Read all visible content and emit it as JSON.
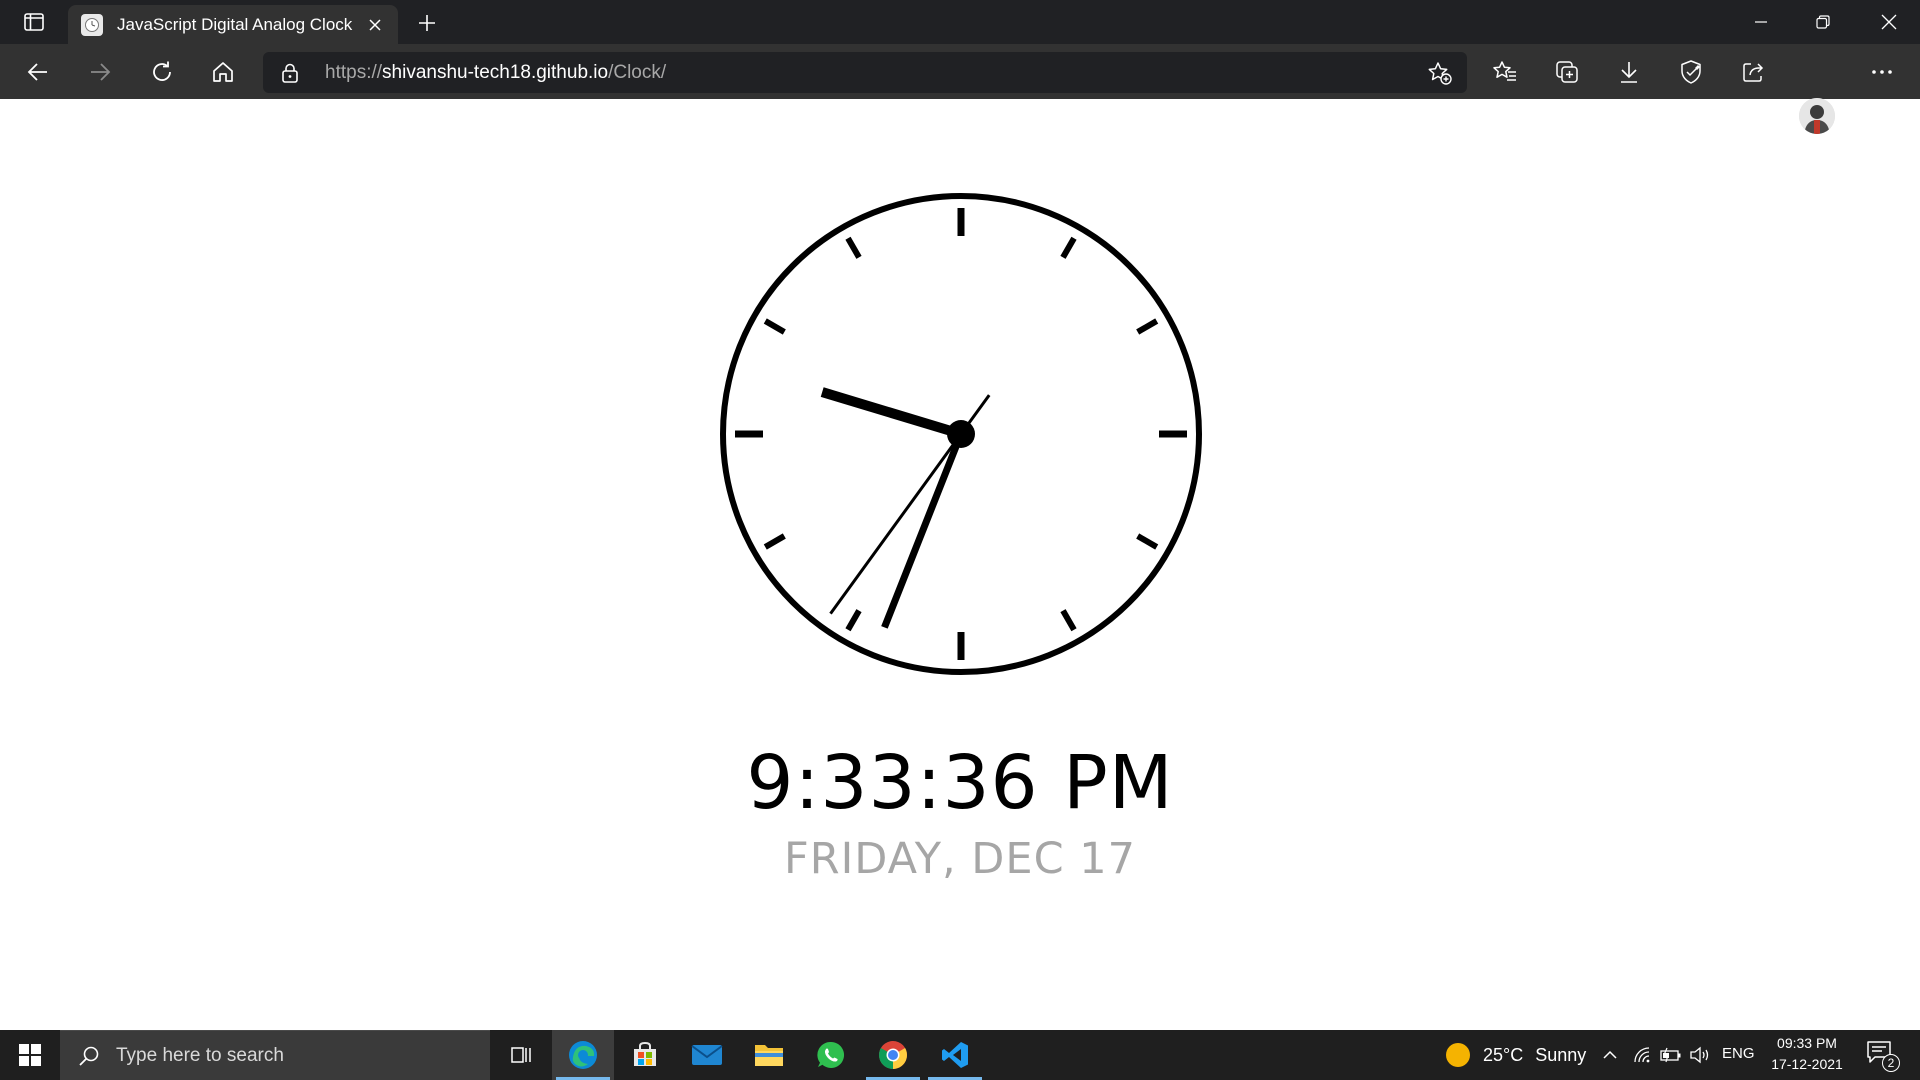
{
  "browser": {
    "tab_title": "JavaScript Digital Analog Clock",
    "url_prefix": "https://",
    "url_host": "shivanshu-tech18.github.io",
    "url_path": "/Clock/"
  },
  "clock": {
    "time_text": "9:33:36 PM",
    "date_text": "FRIDAY, DEC 17",
    "hours": 9,
    "minutes": 33,
    "seconds": 36
  },
  "taskbar": {
    "search_placeholder": "Type here to search",
    "weather_temp": "25°C",
    "weather_condition": "Sunny",
    "language": "ENG",
    "time": "09:33 PM",
    "date": "17-12-2021",
    "notification_count": "2",
    "apps": [
      "task-view",
      "edge",
      "microsoft-store",
      "mail",
      "file-explorer",
      "whatsapp",
      "chrome",
      "vscode"
    ]
  },
  "colors": {
    "chrome_dark": "#202124",
    "toolbar": "#323232",
    "date_text": "#a6a6a6",
    "taskbar": "#1f1f1f"
  }
}
